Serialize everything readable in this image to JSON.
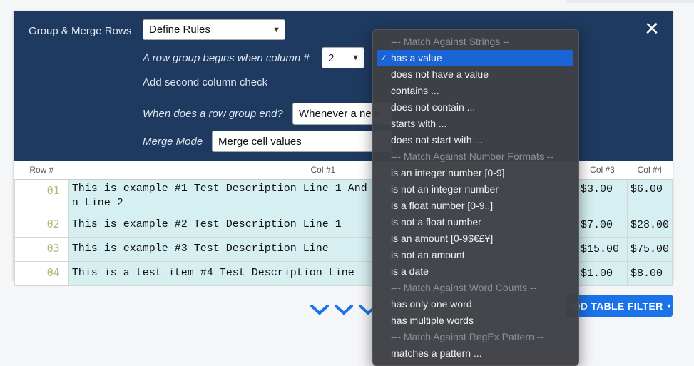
{
  "panel": {
    "title": "Group & Merge Rows",
    "rules_select": "Define Rules",
    "begins_label": "A row group begins when column #",
    "column_select": "2",
    "add_second": "Add second column check",
    "ends_label": "When does a row group end?",
    "ends_select": "Whenever a new",
    "merge_label": "Merge Mode",
    "merge_select": "Merge cell values",
    "close": "✕"
  },
  "table": {
    "headers": [
      "Row #",
      "Col #1",
      "Col #3",
      "Col #4"
    ],
    "rows": [
      {
        "num": "01",
        "col1": "This is example #1 Test Description Line 1 And",
        "col1b": "n Line 2",
        "col3": "$3.00",
        "col4": "$6.00"
      },
      {
        "num": "02",
        "col1": "This is example #2 Test Description Line 1",
        "col3": "$7.00",
        "col4": "$28.00"
      },
      {
        "num": "03",
        "col1": "This is example #3 Test Description Line",
        "col3": "$15.00",
        "col4": "$75.00"
      },
      {
        "num": "04",
        "col1": "This is a test item #4 Test Description Line",
        "col3": "$1.00",
        "col4": "$8.00"
      }
    ]
  },
  "add_filter_button": "ADD TABLE FILTER",
  "dropdown": {
    "options": [
      {
        "label": "--- Match Against Strings --",
        "group": true
      },
      {
        "label": "has a value",
        "selected": true
      },
      {
        "label": "does not have a value"
      },
      {
        "label": "contains ..."
      },
      {
        "label": "does not contain ..."
      },
      {
        "label": "starts with ..."
      },
      {
        "label": "does not start with ..."
      },
      {
        "label": "--- Match Against Number Formats --",
        "group": true
      },
      {
        "label": "is an integer number [0-9]"
      },
      {
        "label": "is not an integer number"
      },
      {
        "label": "is a float number [0-9,.]"
      },
      {
        "label": "is not a float number"
      },
      {
        "label": "is an amount [0-9$€£¥]"
      },
      {
        "label": "is not an amount"
      },
      {
        "label": "is a date"
      },
      {
        "label": "--- Match Against Word Counts --",
        "group": true
      },
      {
        "label": "has only one word"
      },
      {
        "label": "has multiple words"
      },
      {
        "label": "--- Match Against RegEx Pattern --",
        "group": true
      },
      {
        "label": "matches a pattern ..."
      }
    ]
  },
  "colors": {
    "panel": "#1f3a60",
    "accent": "#1a73e8",
    "cell": "#d6f0f2"
  },
  "icons": {
    "close": "close-icon",
    "chevrons": "chevron-down-icon"
  }
}
